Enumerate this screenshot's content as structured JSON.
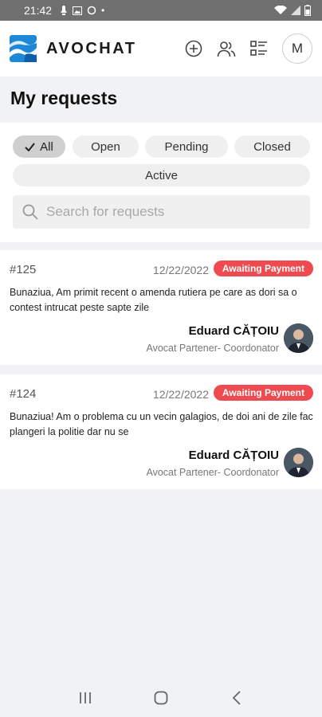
{
  "status_bar": {
    "time": "21:42"
  },
  "app": {
    "brand": "AVOCHAT",
    "avatar_initial": "M"
  },
  "page": {
    "title": "My requests"
  },
  "filters": {
    "chips": [
      "All",
      "Open",
      "Pending",
      "Closed",
      "Active"
    ],
    "selected": "All",
    "search_placeholder": "Search for requests"
  },
  "requests": [
    {
      "id": "#125",
      "date": "12/22/2022",
      "status": "Awaiting Payment",
      "description": "Bunaziua, Am primit recent o amenda rutiera pe care as dori sa o contest intrucat peste sapte zile",
      "lawyer_name": "Eduard CĂȚOIU",
      "lawyer_role": "Avocat Partener- Coordonator"
    },
    {
      "id": "#124",
      "date": "12/22/2022",
      "status": "Awaiting Payment",
      "description": "Bunaziua! Am o problema cu un vecin galagios, de doi ani de zile fac plangeri la politie dar nu se",
      "lawyer_name": "Eduard CĂȚOIU",
      "lawyer_role": "Avocat Partener- Coordonator"
    }
  ],
  "colors": {
    "badge": "#ef4a4f",
    "brand_blue": "#1e88d6",
    "selected_chip": "#cfcfcf"
  }
}
